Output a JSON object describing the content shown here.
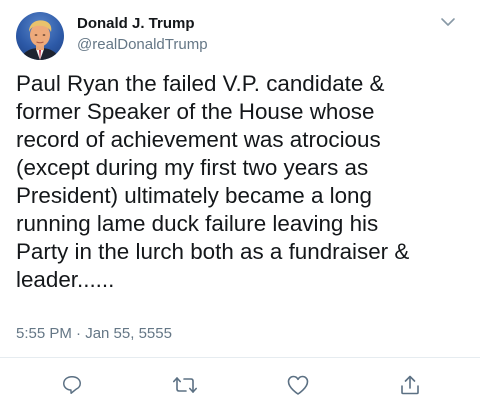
{
  "author": {
    "name": "Donald J. Trump",
    "handle": "@realDonaldTrump"
  },
  "tweet": {
    "lines": [
      "Paul Ryan the failed V.P. candidate &",
      "former Speaker of the House whose",
      "record of achievement was atrocious",
      "(except during my first two years as",
      "President) ultimately became a long",
      "running lame duck failure leaving his",
      "Party in the lurch both as a fundraiser &",
      "leader......"
    ],
    "timestamp": "5:55 PM · Jan 55, 5555"
  },
  "actions": {
    "icons": [
      "reply-icon",
      "retweet-icon",
      "like-icon",
      "share-icon"
    ]
  },
  "colors": {
    "text": "#14171a",
    "secondary": "#657786",
    "divider": "#e6ecf0"
  }
}
